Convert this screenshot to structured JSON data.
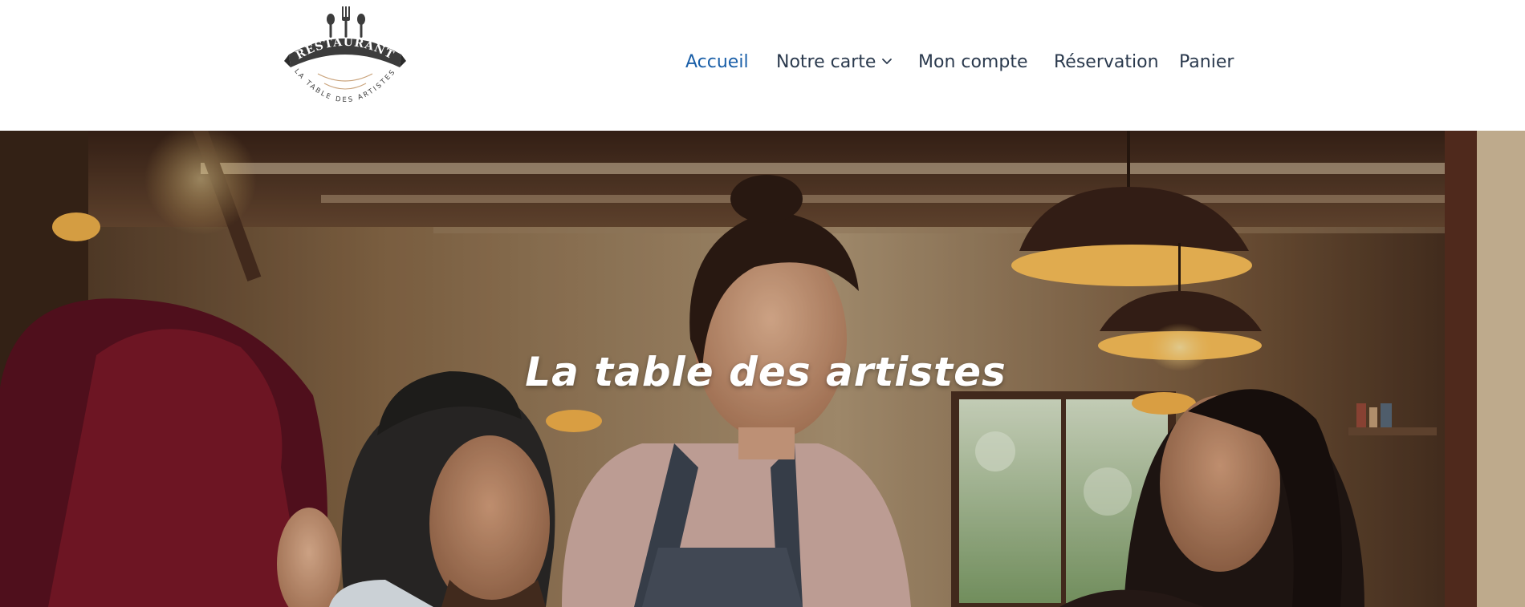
{
  "brand": {
    "logo_top_text": "RESTAURANT",
    "logo_bottom_text": "LA TABLE DES ARTISTES",
    "icon": "cutlery-icon"
  },
  "nav": {
    "items": [
      {
        "label": "Accueil",
        "active": true
      },
      {
        "label": "Notre carte",
        "has_dropdown": true,
        "icon": "chevron-down-icon"
      },
      {
        "label": "Mon compte"
      },
      {
        "label": "Réservation"
      },
      {
        "label": "Panier"
      }
    ]
  },
  "colors": {
    "nav_text": "#2b3a4e",
    "nav_active": "#1a5fa8",
    "logo_dark": "#3c3c3c",
    "logo_accent": "#c9a27a"
  },
  "hero": {
    "title": "La table des artistes"
  }
}
